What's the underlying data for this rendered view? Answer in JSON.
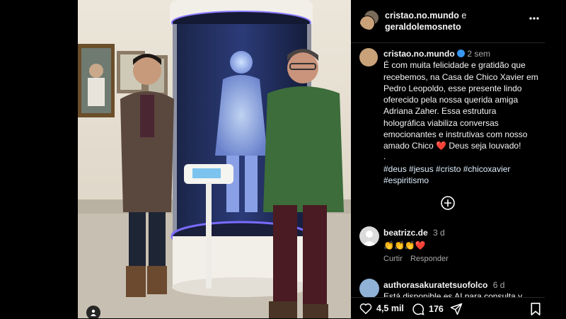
{
  "header": {
    "user1": "cristao.no.mundo",
    "conj": "e",
    "user2": "geraldolemosneto",
    "more_icon": "more-horizontal-icon"
  },
  "caption": {
    "username": "cristao.no.mundo",
    "time": "2 sem",
    "text": "É com muita felicidade e gratidão que recebemos, na Casa de Chico Xavier em Pedro Leopoldo, esse presente lindo oferecido pela nossa querida amiga Adriana Zaher. Essa estrutura holográfica viabiliza conversas emocionantes e instrutivas com nosso amado Chico",
    "text_end": " Deus seja louvado!",
    "dot": ".",
    "hashtags": "#deus #jesus #cristo #chicoxavier #espiritismo"
  },
  "comments": [
    {
      "username": "beatrizc.de",
      "time": "3 d",
      "text": "👏👏👏❤️",
      "reply_actions": [
        "Curtir",
        "Responder"
      ]
    },
    {
      "username": "authorasakuratetsuofolco",
      "time": "6 d",
      "text": "Está disponible es AI para consulta y"
    }
  ],
  "actions": {
    "likes": "4,5 mil",
    "comments": "176"
  },
  "colors": {
    "panel_bg": "#000000",
    "verified": "#3897f0",
    "heart": "#ff3040"
  }
}
